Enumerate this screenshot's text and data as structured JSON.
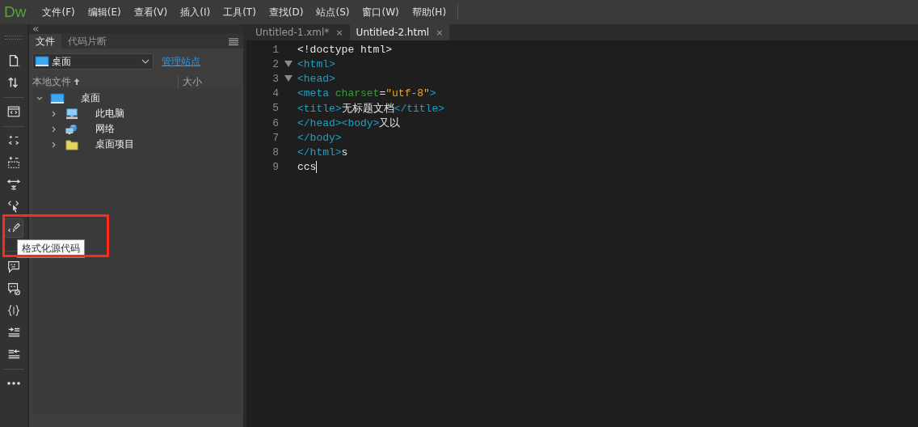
{
  "app": {
    "logo": "Dw"
  },
  "menu": [
    "文件(F)",
    "编辑(E)",
    "查看(V)",
    "插入(I)",
    "工具(T)",
    "查找(D)",
    "站点(S)",
    "窗口(W)",
    "帮助(H)"
  ],
  "toolbar": [
    {
      "kind": "new-file",
      "hovered": false
    },
    {
      "kind": "transfer",
      "hovered": false
    },
    {
      "kind": "code-view",
      "hovered": false
    },
    {
      "kind": "expand",
      "hovered": false
    },
    {
      "kind": "select-region",
      "hovered": false
    },
    {
      "kind": "collapse",
      "hovered": false
    },
    {
      "kind": "select-tag",
      "hovered": false
    },
    {
      "kind": "format",
      "hovered": true,
      "tooltip": "格式化源代码"
    },
    {
      "kind": "comment",
      "hovered": false
    },
    {
      "kind": "uncomment",
      "hovered": false
    },
    {
      "kind": "braces",
      "hovered": false
    },
    {
      "kind": "indent",
      "hovered": false
    },
    {
      "kind": "outdent",
      "hovered": false
    },
    {
      "kind": "more",
      "hovered": false
    }
  ],
  "panel": {
    "tabs": [
      {
        "label": "文件",
        "selected": true
      },
      {
        "label": "代码片断",
        "selected": false
      }
    ],
    "site": {
      "value": "桌面",
      "link": "管理站点"
    },
    "columns": [
      "本地文件",
      "大小"
    ],
    "tree": [
      {
        "label": "桌面",
        "kind": "desktop",
        "expanded": true,
        "children": [
          {
            "label": "此电脑",
            "kind": "computer",
            "expanded": false
          },
          {
            "label": "网络",
            "kind": "network",
            "expanded": false
          },
          {
            "label": "桌面项目",
            "kind": "folder",
            "expanded": false
          }
        ]
      }
    ]
  },
  "editor": {
    "tabs": [
      {
        "label": "Untitled-1.xml*",
        "selected": false,
        "close": "×"
      },
      {
        "label": "Untitled-2.html",
        "selected": true,
        "close": "×"
      }
    ],
    "lines": [
      {
        "number": "1",
        "fold": false,
        "tokens": [
          {
            "kind": "plain",
            "text": "<!doctype html>"
          }
        ]
      },
      {
        "number": "2",
        "fold": true,
        "tokens": [
          {
            "kind": "tag",
            "text": "<html>"
          }
        ]
      },
      {
        "number": "3",
        "fold": true,
        "tokens": [
          {
            "kind": "tag",
            "text": "<head>"
          }
        ]
      },
      {
        "number": "4",
        "fold": false,
        "tokens": [
          {
            "kind": "tag",
            "text": "<meta "
          },
          {
            "kind": "attr",
            "text": "charset"
          },
          {
            "kind": "plain",
            "text": "="
          },
          {
            "kind": "string",
            "text": "\"utf-8\""
          },
          {
            "kind": "tag",
            "text": ">"
          }
        ]
      },
      {
        "number": "5",
        "fold": false,
        "tokens": [
          {
            "kind": "tag",
            "text": "<title>"
          },
          {
            "kind": "plain",
            "text": "无标题文档"
          },
          {
            "kind": "tag",
            "text": "</title>"
          }
        ]
      },
      {
        "number": "6",
        "fold": false,
        "tokens": [
          {
            "kind": "tag",
            "text": "</head><body>"
          },
          {
            "kind": "plain",
            "text": "又以"
          }
        ]
      },
      {
        "number": "7",
        "fold": false,
        "tokens": [
          {
            "kind": "tag",
            "text": "</body>"
          }
        ]
      },
      {
        "number": "8",
        "fold": false,
        "tokens": [
          {
            "kind": "tag",
            "text": "</html>"
          },
          {
            "kind": "plain",
            "text": "s"
          }
        ]
      },
      {
        "number": "9",
        "fold": false,
        "cursor": true,
        "tokens": [
          {
            "kind": "plain",
            "text": "ccs"
          }
        ]
      }
    ]
  },
  "annotation": {
    "kind": "highlight-frame"
  }
}
